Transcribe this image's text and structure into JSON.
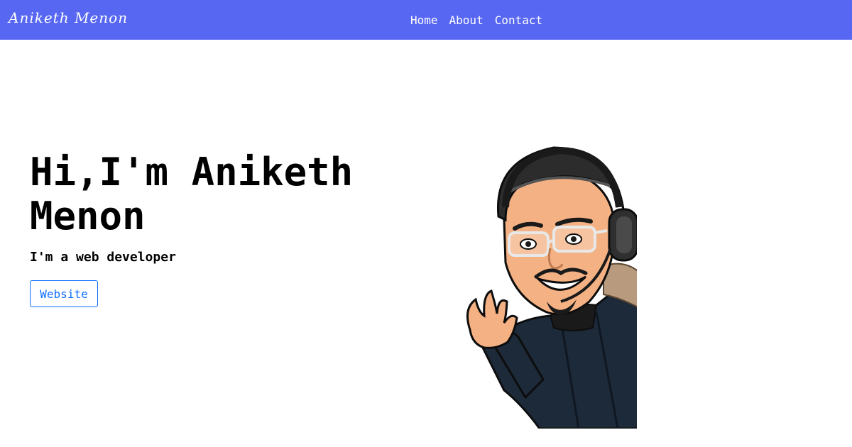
{
  "navbar": {
    "brand": "Aniketh Menon",
    "links": [
      "Home",
      "About",
      "Contact"
    ]
  },
  "hero": {
    "title": "Hi,I'm Aniketh Menon",
    "subtitle": "I'm a web developer",
    "button_label": "Website"
  },
  "colors": {
    "navbar_bg": "#5867f2",
    "button_accent": "#0d6efd"
  }
}
